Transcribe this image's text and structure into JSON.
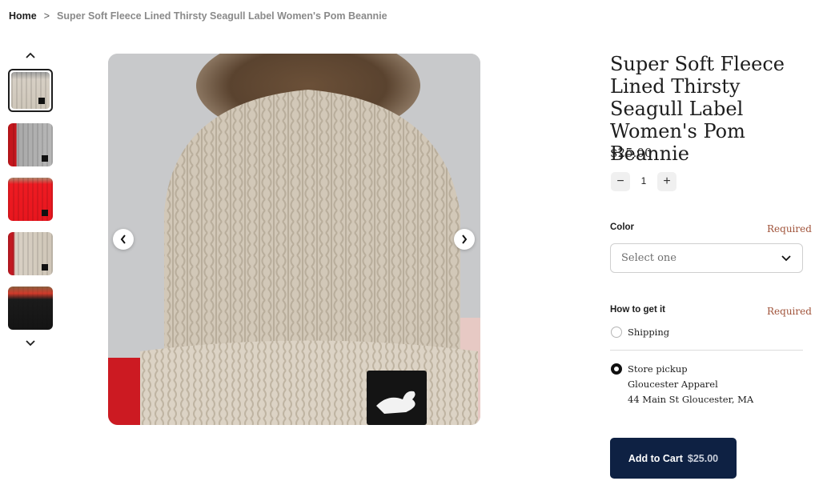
{
  "breadcrumb": {
    "home": "Home",
    "separator": ">",
    "current": "Super Soft Fleece Lined Thirsty Seagull Label Women's Pom Beannie"
  },
  "gallery": {
    "thumbnails": [
      {
        "alt": "beige beanie",
        "color": "#c9bfb2",
        "active": true
      },
      {
        "alt": "grey beanie",
        "color": "#a8a8a8",
        "active": false
      },
      {
        "alt": "red beanie",
        "color": "#e8161e",
        "active": false
      },
      {
        "alt": "cream beanie",
        "color": "#d8d0c4",
        "active": false
      },
      {
        "alt": "black beanie",
        "color": "#1b1b1b",
        "active": false
      }
    ],
    "up_icon": "chevron-up-icon",
    "down_icon": "chevron-down-icon",
    "prev_icon": "chevron-left-icon",
    "next_icon": "chevron-right-icon"
  },
  "product": {
    "title": "Super Soft Fleece Lined Thirsty Seagull Label Women's Pom Beannie",
    "price": "$25.00",
    "quantity": "1",
    "minus": "−",
    "plus": "+"
  },
  "options": {
    "color_label": "Color",
    "color_required": "Required",
    "color_placeholder": "Select one",
    "fulfillment_label": "How to get it",
    "fulfillment_required": "Required",
    "shipping": "Shipping",
    "pickup": "Store pickup",
    "pickup_store": "Gloucester Apparel",
    "pickup_address": "44 Main St Gloucester, MA"
  },
  "cart": {
    "label": "Add to Cart",
    "price": "$25.00",
    "color": "#0e2143"
  }
}
